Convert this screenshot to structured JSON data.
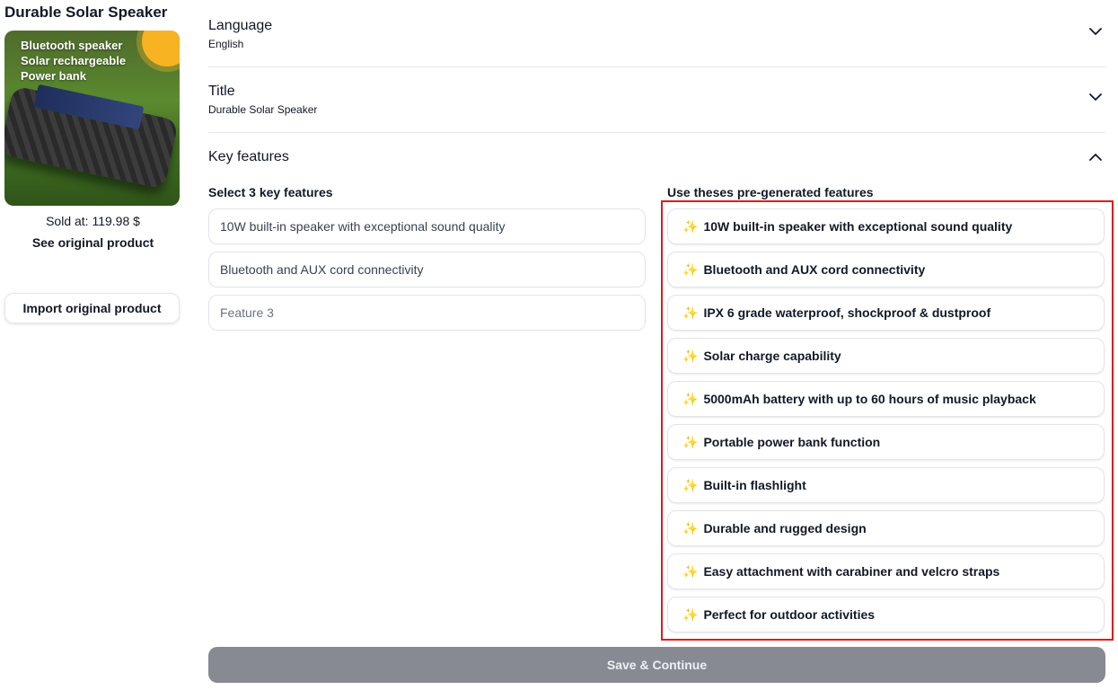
{
  "product": {
    "title": "Durable Solar Speaker",
    "image_lines": [
      "Bluetooth speaker",
      "Solar rechargeable",
      "Power bank"
    ],
    "sold_at": "Sold at: 119.98 $",
    "see_original": "See original product",
    "import_button": "Import original product"
  },
  "sections": {
    "language": {
      "label": "Language",
      "value": "English",
      "icon": "chevron-down-icon"
    },
    "title": {
      "label": "Title",
      "value": "Durable Solar Speaker",
      "icon": "chevron-down-icon"
    },
    "key_features": {
      "label": "Key features",
      "icon": "chevron-up-icon"
    }
  },
  "key_features": {
    "select_label": "Select 3 key features",
    "inputs": [
      {
        "value": "10W built-in speaker with exceptional sound quality",
        "placeholder": ""
      },
      {
        "value": "Bluetooth and AUX cord connectivity",
        "placeholder": ""
      },
      {
        "value": "",
        "placeholder": "Feature 3"
      }
    ],
    "pregenerated_label": "Use theses pre-generated features",
    "sparkle_icon": "✨",
    "pregenerated": [
      "10W built-in speaker with exceptional sound quality",
      "Bluetooth and AUX cord connectivity",
      "IPX 6 grade waterproof, shockproof & dustproof",
      "Solar charge capability",
      "5000mAh battery with up to 60 hours of music playback",
      "Portable power bank function",
      "Built-in flashlight",
      "Durable and rugged design",
      "Easy attachment with carabiner and velcro straps",
      "Perfect for outdoor activities"
    ]
  },
  "save_button": "Save & Continue",
  "colors": {
    "highlight": "#e21b1b",
    "save_button_bg": "#878a92",
    "sparkle": "#f4b400"
  }
}
